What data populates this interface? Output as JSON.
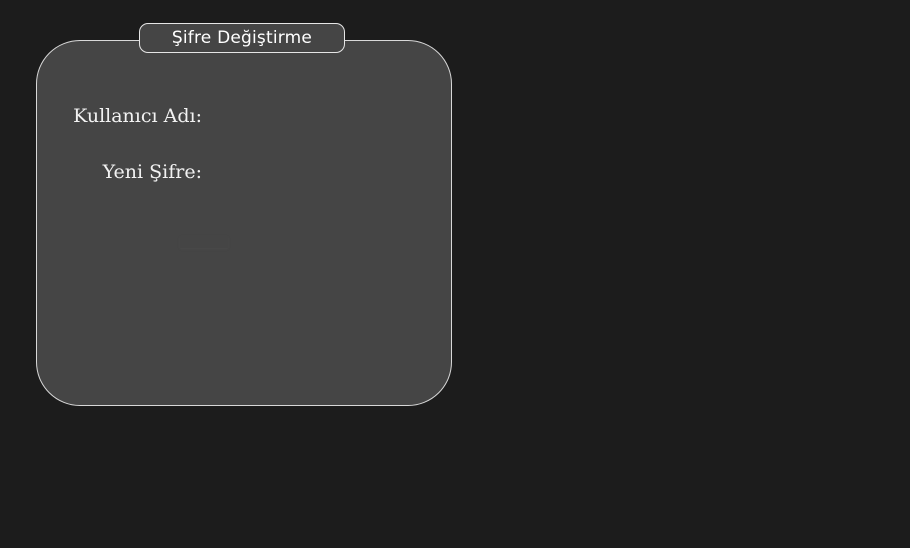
{
  "dialog": {
    "title": "Şifre Değiştirme",
    "fields": {
      "username_label": "Kullanıcı Adı:",
      "username_value": "",
      "new_password_label": "Yeni Şifre:",
      "new_password_value": ""
    }
  },
  "colors": {
    "background": "#1c1c1c",
    "panel": "#454545",
    "panel_border": "#d8d8d8",
    "text": "#f2f2f2"
  }
}
